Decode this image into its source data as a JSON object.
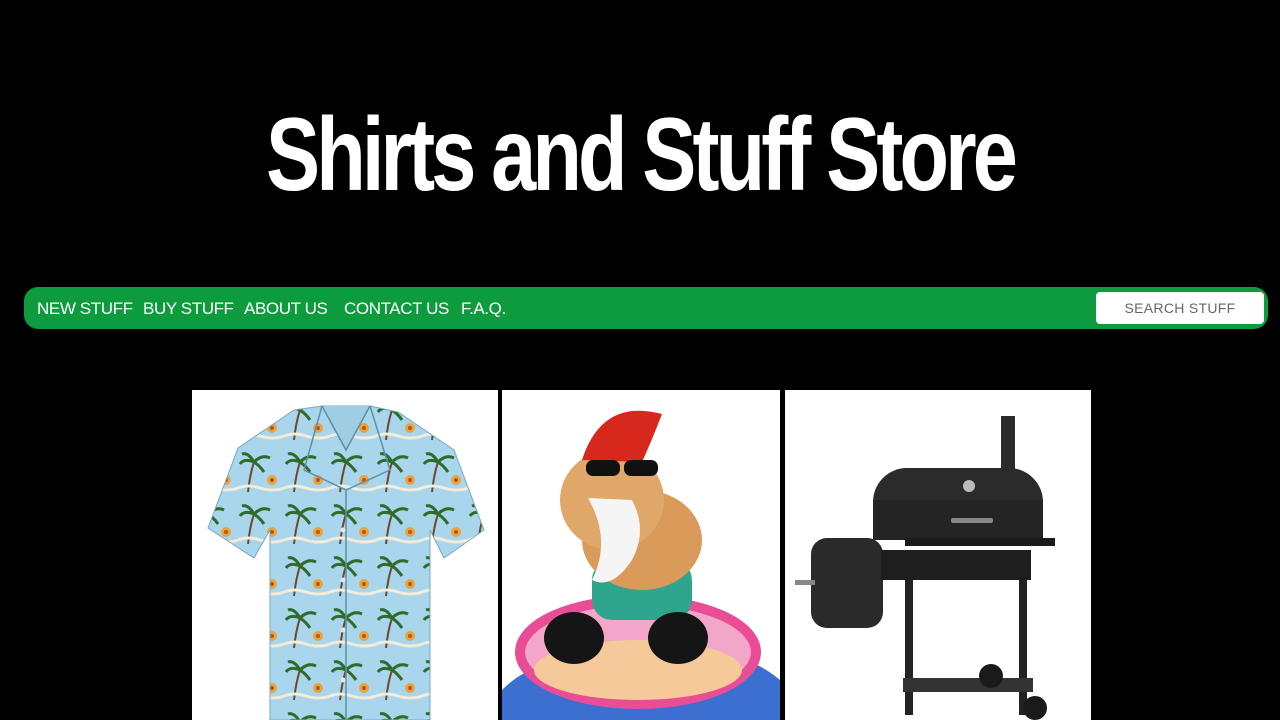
{
  "header": {
    "title": "Shirts and Stuff Store"
  },
  "nav": {
    "items": [
      {
        "label": "NEW STUFF"
      },
      {
        "label": "BUY STUFF"
      },
      {
        "label": "ABOUT US"
      },
      {
        "label": "CONTACT US"
      },
      {
        "label": "F.A.Q."
      }
    ],
    "search": {
      "placeholder": "SEARCH STUFF"
    }
  },
  "products": [
    {
      "image": "hawaiian-shirt"
    },
    {
      "image": "garden-gnome-float"
    },
    {
      "image": "charcoal-grill-smoker"
    }
  ],
  "colors": {
    "background": "#000000",
    "nav": "#0c9c3e",
    "title": "#ffffff"
  }
}
